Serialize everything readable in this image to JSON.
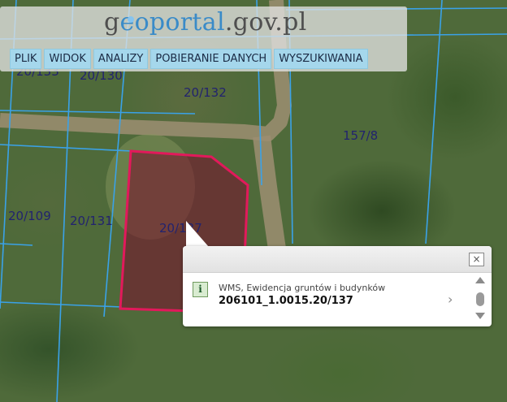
{
  "logo": {
    "prefix": "g",
    "highlight": "eoportal",
    "suffix": ".gov.pl"
  },
  "menu": {
    "items": [
      {
        "label": "PLIK"
      },
      {
        "label": "WIDOK"
      },
      {
        "label": "ANALIZY"
      },
      {
        "label": "POBIERANIE DANYCH"
      },
      {
        "label": "WYSZUKIWANIA"
      }
    ]
  },
  "map": {
    "parcels": [
      {
        "label": "20/132"
      },
      {
        "label": "157/8"
      },
      {
        "label": "20/109"
      },
      {
        "label": "20/131"
      },
      {
        "label": "20/137"
      },
      {
        "label": "20/130"
      },
      {
        "label": "20/133"
      }
    ],
    "colors": {
      "parcel_line": "#3aa2e8",
      "selection_outline": "#e2195b",
      "selection_fill": "#7a0d2e",
      "parcel_label": "#22236e"
    }
  },
  "popup": {
    "layer_name": "WMS, Ewidencja gruntów i budynków",
    "parcel_id": "206101_1.0015.20/137",
    "info_icon_text": "i",
    "close_icon_text": "×",
    "next_icon_text": "›"
  }
}
